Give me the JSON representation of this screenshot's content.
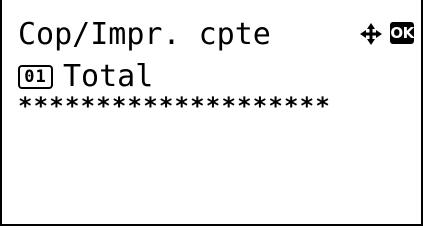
{
  "screen": {
    "title": "Cop/Impr. cpte",
    "nav_icon": "four-way-arrow-icon",
    "ok_label": "OK"
  },
  "menu": {
    "item_number": "01",
    "item_label": "Total"
  },
  "entry": {
    "masked_value": "********************"
  }
}
